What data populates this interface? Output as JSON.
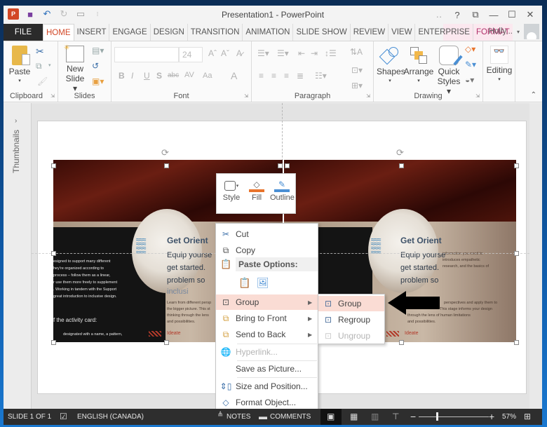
{
  "app": {
    "title": "Presentation1 - PowerPoint",
    "qat": [
      {
        "name": "powerpoint-logo-icon",
        "glyph": "P"
      },
      {
        "name": "save-icon",
        "glyph": "▪"
      },
      {
        "name": "undo-icon",
        "glyph": "↶"
      },
      {
        "name": "redo-icon",
        "glyph": "↻"
      },
      {
        "name": "start-from-beginning-icon",
        "glyph": "▭"
      },
      {
        "name": "customize-qat-icon",
        "glyph": "⁝"
      }
    ],
    "window_buttons": {
      "help": "?",
      "restore_ribbon": "⧉",
      "minimize": "—",
      "maximize": "☐",
      "close": "✕"
    }
  },
  "tabs": [
    {
      "label": "FILE",
      "kind": "file"
    },
    {
      "label": "HOME",
      "kind": "active"
    },
    {
      "label": "INSERT"
    },
    {
      "label": "ENGAGE"
    },
    {
      "label": "DESIGN"
    },
    {
      "label": "TRANSITION"
    },
    {
      "label": "ANIMATION"
    },
    {
      "label": "SLIDE SHOW"
    },
    {
      "label": "REVIEW"
    },
    {
      "label": "VIEW"
    },
    {
      "label": "ENTERPRISE"
    },
    {
      "label": "FORMAT",
      "kind": "contextual"
    }
  ],
  "user": {
    "name": "Holly...",
    "dropdown": "▾"
  },
  "ribbon": {
    "clipboard": {
      "label": "Clipboard",
      "paste": "Paste"
    },
    "slides": {
      "label": "Slides",
      "new_slide_line1": "New",
      "new_slide_line2": "Slide ▾"
    },
    "font": {
      "label": "Font",
      "font_name": "",
      "font_size": "24",
      "buttons": [
        "B",
        "I",
        "U",
        "S",
        "abc",
        "AV",
        "Aa",
        "A"
      ]
    },
    "paragraph": {
      "label": "Paragraph"
    },
    "drawing": {
      "label": "Drawing",
      "shapes": "Shapes",
      "arrange": "Arrange",
      "quick_line1": "Quick",
      "quick_line2": "Styles ▾"
    },
    "editing": {
      "label": "Editing"
    }
  },
  "thumbnails_label": "Thumbnails",
  "slide_content": {
    "heading": "Get Orient",
    "body_lines": [
      "Equip yourse",
      "get started.",
      "problem so",
      "inclusi"
    ],
    "left_text": [
      "esigned to support many different",
      "hey're organized according to",
      "process – follow them as a linear,",
      "r use them more freely to supplement",
      ". Working in tandem with the Support",
      "great introduction to inclusive design."
    ],
    "left_subhead": "f the activity card:",
    "left_footer": "designated with a name, a pattern,",
    "right_text": [
      "Learn from different persp",
      "the bigger picture. This st",
      "thinking through the lens",
      "and possibilities."
    ],
    "right2_text": [
      "information you need to",
      "introduces empathetic",
      "research, and the basics of"
    ],
    "right2_lower": [
      "perspectives and apply them to",
      "This stage informs your design",
      "through the lens of human limitations",
      "and possibilities."
    ],
    "ideate": "Ideate"
  },
  "minibar": [
    {
      "label": "Style",
      "icon": "style-icon"
    },
    {
      "label": "Fill",
      "icon": "fill-icon",
      "color": "#e8742c"
    },
    {
      "label": "Outline",
      "icon": "outline-icon",
      "color": "#4a8fd4"
    }
  ],
  "context_menu": {
    "cut": "Cut",
    "copy": "Copy",
    "paste_options": "Paste Options:",
    "group": "Group",
    "bring_to_front": "Bring to Front",
    "send_to_back": "Send to Back",
    "hyperlink": "Hyperlink...",
    "save_as_picture": "Save as Picture...",
    "size_and_position": "Size and Position...",
    "format_object": "Format Object..."
  },
  "submenu": {
    "group": "Group",
    "regroup": "Regroup",
    "ungroup": "Ungroup"
  },
  "statusbar": {
    "slide": "SLIDE 1 OF 1",
    "language": "ENGLISH (CANADA)",
    "notes": "NOTES",
    "comments": "COMMENTS",
    "zoom": "57%",
    "zoom_minus": "−",
    "zoom_plus": "+"
  },
  "zoom_level_percent": 57,
  "colors": {
    "accent": "#d24726",
    "format_tab": "#b0306a",
    "menu_highlight": "#fadcd4"
  }
}
